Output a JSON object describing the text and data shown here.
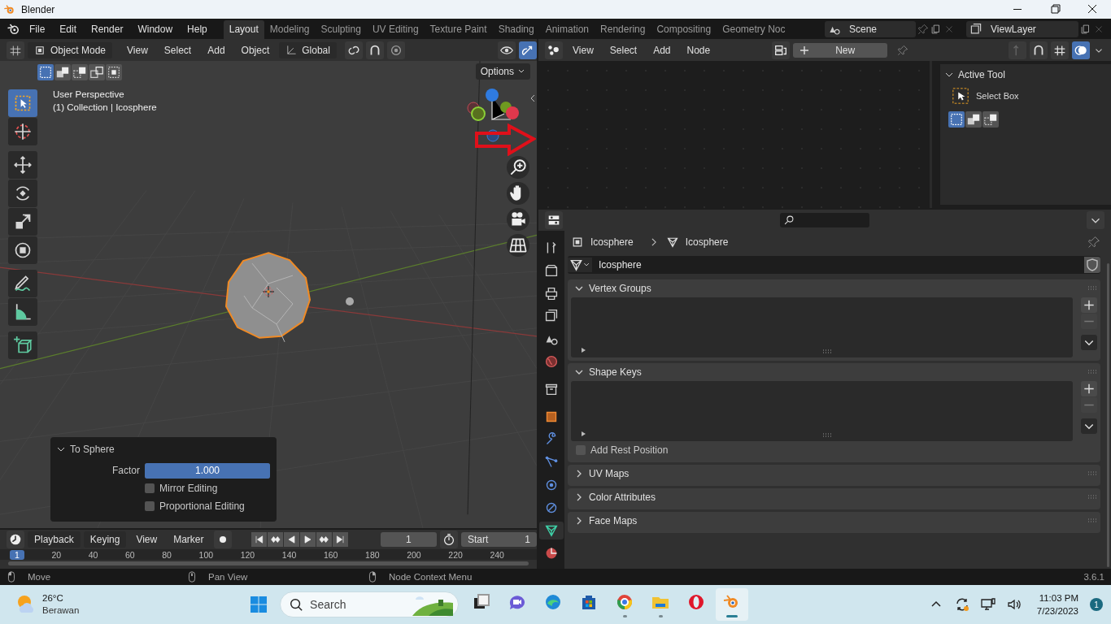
{
  "window": {
    "title": "Blender"
  },
  "menu": [
    "File",
    "Edit",
    "Render",
    "Window",
    "Help"
  ],
  "workspaces": [
    {
      "label": "Layout",
      "selected": true
    },
    {
      "label": "Modeling",
      "selected": false
    },
    {
      "label": "Sculpting",
      "selected": false
    },
    {
      "label": "UV Editing",
      "selected": false
    },
    {
      "label": "Texture Paint",
      "selected": false
    },
    {
      "label": "Shading",
      "selected": false
    },
    {
      "label": "Animation",
      "selected": false
    },
    {
      "label": "Rendering",
      "selected": false
    },
    {
      "label": "Compositing",
      "selected": false
    },
    {
      "label": "Geometry Noc",
      "selected": false
    }
  ],
  "scene": {
    "name": "Scene"
  },
  "view_layer": {
    "name": "ViewLayer"
  },
  "viewport": {
    "mode": "Object Mode",
    "menus": [
      "View",
      "Select",
      "Add",
      "Object"
    ],
    "orientation": "Global",
    "options": "Options",
    "info": [
      "User Perspective",
      "(1) Collection | Icosphere"
    ],
    "select_modes": [
      {
        "kind": "set",
        "selected": true
      },
      {
        "kind": "extend",
        "selected": false
      },
      {
        "kind": "subtract",
        "selected": false
      },
      {
        "kind": "invert",
        "selected": false
      },
      {
        "kind": "intersect",
        "selected": false
      }
    ],
    "tools": [
      {
        "kind": "select",
        "selected": true
      },
      {
        "kind": "cursor",
        "selected": false
      },
      {
        "kind": "move",
        "selected": false
      },
      {
        "kind": "rotate",
        "selected": false
      },
      {
        "kind": "scale",
        "selected": false
      },
      {
        "kind": "transform",
        "selected": false
      },
      {
        "kind": "annotate",
        "selected": false
      },
      {
        "kind": "measure",
        "selected": false
      },
      {
        "kind": "add_cube",
        "selected": false
      }
    ]
  },
  "operator_panel": {
    "title": "To Sphere",
    "factor_label": "Factor",
    "factor_value": "1.000",
    "level": 1,
    "options": [
      {
        "label": "Mirror Editing",
        "checked": false
      },
      {
        "label": "Proportional Editing",
        "checked": false
      }
    ]
  },
  "node_editor": {
    "menus": [
      "View",
      "Select",
      "Add",
      "Node"
    ],
    "new_button": "New",
    "sidebar": {
      "title": "Active Tool",
      "tool": "Select Box"
    }
  },
  "properties": {
    "breadcrumb": [
      "Icosphere",
      "Icosphere"
    ],
    "data_name": "Icosphere",
    "tabs": [
      {
        "kind": "tool",
        "selected": false
      },
      {
        "kind": "render",
        "selected": false
      },
      {
        "kind": "output",
        "selected": false
      },
      {
        "kind": "view_layer",
        "selected": false
      },
      {
        "kind": "scene",
        "selected": false
      },
      {
        "kind": "world",
        "selected": false
      },
      {
        "kind": "collection",
        "selected": false
      },
      {
        "kind": "object",
        "selected": false
      },
      {
        "kind": "modifier",
        "selected": false
      },
      {
        "kind": "particles",
        "selected": false
      },
      {
        "kind": "physics",
        "selected": false
      },
      {
        "kind": "constraints",
        "selected": false
      },
      {
        "kind": "data",
        "selected": true
      },
      {
        "kind": "material",
        "selected": false
      }
    ],
    "panels": [
      {
        "title": "Vertex Groups",
        "expanded": true
      },
      {
        "title": "Shape Keys",
        "expanded": true,
        "option": {
          "label": "Add Rest Position",
          "checked": false
        }
      },
      {
        "title": "UV Maps",
        "expanded": false
      },
      {
        "title": "Color Attributes",
        "expanded": false
      },
      {
        "title": "Face Maps",
        "expanded": false
      }
    ]
  },
  "timeline": {
    "menus": [
      "Playback",
      "Keying",
      "View",
      "Marker"
    ],
    "current_frame": "1",
    "start_label": "Start",
    "start_value": "1",
    "ruler": [
      "1",
      "20",
      "40",
      "60",
      "80",
      "100",
      "120",
      "140",
      "160",
      "180",
      "200",
      "220",
      "240"
    ]
  },
  "status_bar": {
    "hints": [
      "Move",
      "Pan View",
      "Node Context Menu"
    ],
    "version": "3.6.1"
  },
  "taskbar": {
    "weather": {
      "temperature": "26°C",
      "condition": "Berawan"
    },
    "search": {
      "placeholder": "Search"
    },
    "apps": [
      {
        "kind": "task_view",
        "running": false,
        "selected": false
      },
      {
        "kind": "meet",
        "running": false,
        "selected": false
      },
      {
        "kind": "edge",
        "running": false,
        "selected": false
      },
      {
        "kind": "store",
        "running": false,
        "selected": false
      },
      {
        "kind": "chrome",
        "running": true,
        "selected": false
      },
      {
        "kind": "files",
        "running": true,
        "selected": false
      },
      {
        "kind": "opera",
        "running": false,
        "selected": false
      },
      {
        "kind": "blender",
        "running": true,
        "selected": true
      }
    ],
    "clock": {
      "time": "11:03 PM",
      "date": "7/23/2023"
    },
    "notifications": "1"
  }
}
